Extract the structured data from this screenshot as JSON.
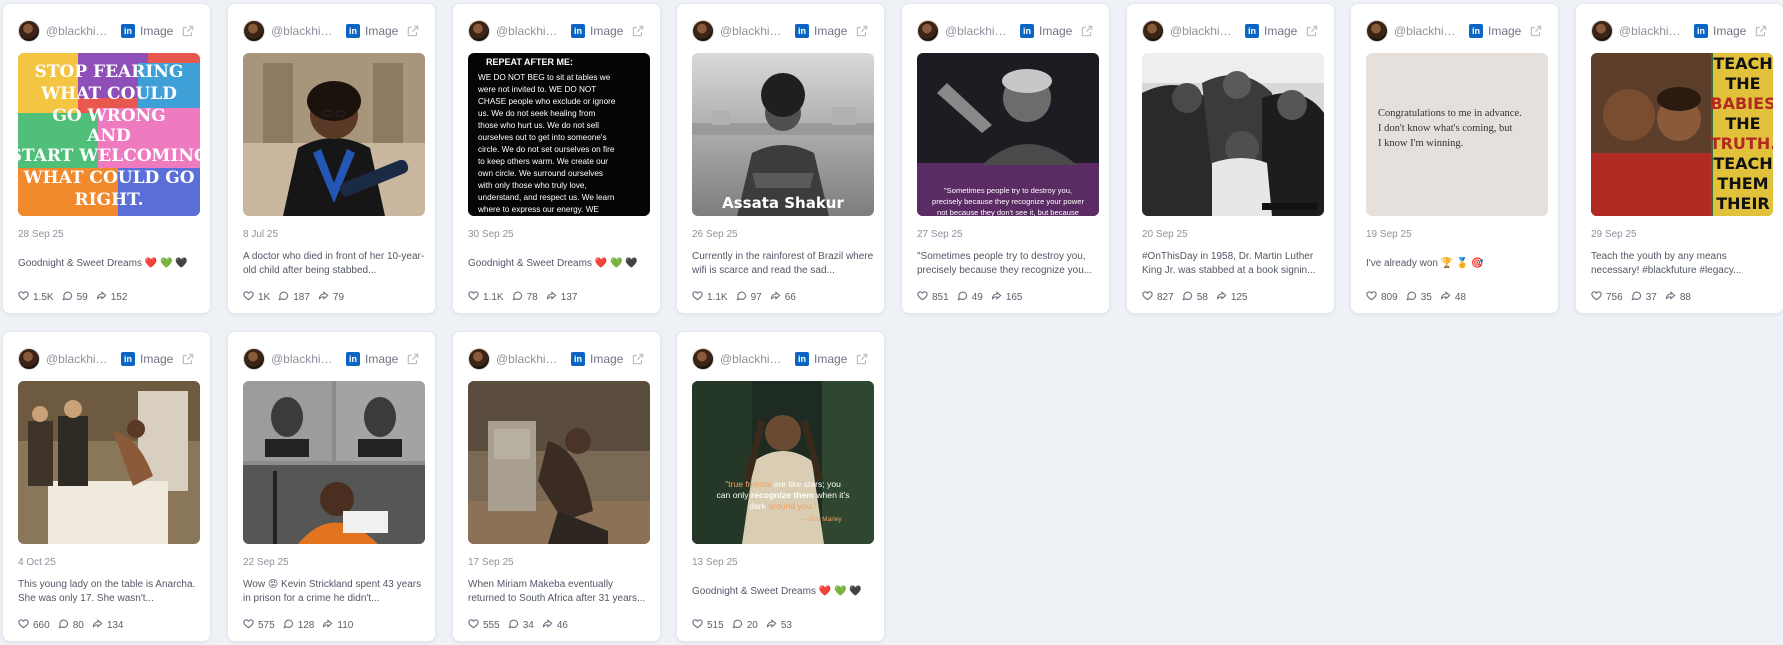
{
  "colors": {
    "linkedin": "#0a66c2",
    "page_background": "#eef1f6",
    "card_background": "#ffffff"
  },
  "icons": {
    "like": "heart-icon",
    "comment": "comment-icon",
    "share": "share-icon",
    "platform": "linkedin-icon",
    "open": "external-link-icon"
  },
  "cards": [
    {
      "handle": "@blackhist...",
      "type": "Image",
      "date": "28 Sep 25",
      "caption": "Goodnight & Sweet Dreams ❤️ 💚 🖤",
      "likes": "1.5K",
      "comments": "59",
      "shares": "152",
      "image_text": "STOP FEARING WHAT COULD GO WRONG AND START WELCOMING WHAT COULD GO RIGHT."
    },
    {
      "handle": "@blackhist...",
      "type": "Image",
      "date": "8 Jul 25",
      "caption": "A doctor who died in front of her 10-year-old child after being stabbed...",
      "likes": "1K",
      "comments": "187",
      "shares": "79",
      "image_text": ""
    },
    {
      "handle": "@blackhist...",
      "type": "Image",
      "date": "30 Sep 25",
      "caption": "Goodnight & Sweet Dreams ❤️ 💚 🖤",
      "likes": "1.1K",
      "comments": "78",
      "shares": "137",
      "image_text": "REPEAT AFTER ME: WE DO NOT BEG to sit at tables we were not invited to. WE DO NOT CHASE people who exclude or ignore us. We do not seek healing from those who hurt us. We do not sell ourselves out to get into someone's circle. We do not set ourselves on fire to keep others warm. We create our own circle. We surround ourselves with only those who truly love, understand, and respect us. We learn where to express our energy. WE REMEMBER OUR SELF-WORTH."
    },
    {
      "handle": "@blackhist...",
      "type": "Image",
      "date": "26 Sep 25",
      "caption": "Currently in the rainforest of Brazil where wifi is scarce and read the sad...",
      "likes": "1.1K",
      "comments": "97",
      "shares": "66",
      "image_text": "Assata Shakur"
    },
    {
      "handle": "@blackhist...",
      "type": "Image",
      "date": "27 Sep 25",
      "caption": "\"Sometimes people try to destroy you, precisely because they recognize you...",
      "likes": "851",
      "comments": "49",
      "shares": "165",
      "image_text": "\"Sometimes people try to destroy you, precisely because they recognize your power not because they don't see it, but because"
    },
    {
      "handle": "@blackhist...",
      "type": "Image",
      "date": "20 Sep 25",
      "caption": "#OnThisDay in 1958, Dr. Martin Luther King Jr. was stabbed at a book signin...",
      "likes": "827",
      "comments": "58",
      "shares": "125",
      "image_text": ""
    },
    {
      "handle": "@blackhist...",
      "type": "Image",
      "date": "19 Sep 25",
      "caption": "I've already won 🏆 🏅 🎯",
      "likes": "809",
      "comments": "35",
      "shares": "48",
      "image_text": "Congratulations to me in advance. I don't know what's coming, but I know I'm winning."
    },
    {
      "handle": "@blackhist...",
      "type": "Image",
      "date": "29 Sep 25",
      "caption": "Teach the youth by any means necessary! #blackfuture #legacy...",
      "likes": "756",
      "comments": "37",
      "shares": "88",
      "image_text": "TEACH THE BABIES THE TRUTH. TEACH THEM THEIR"
    },
    {
      "handle": "@blackhist...",
      "type": "Image",
      "date": "4 Oct 25",
      "caption": "This young lady on the table is Anarcha. She was only 17. She wasn't...",
      "likes": "660",
      "comments": "80",
      "shares": "134",
      "image_text": ""
    },
    {
      "handle": "@blackhist...",
      "type": "Image",
      "date": "22 Sep 25",
      "caption": "Wow 😡 Kevin Strickland spent 43 years in prison for a crime he didn't...",
      "likes": "575",
      "comments": "128",
      "shares": "110",
      "image_text": ""
    },
    {
      "handle": "@blackhist...",
      "type": "Image",
      "date": "17 Sep 25",
      "caption": "When Miriam Makeba eventually returned to South Africa after 31 years...",
      "likes": "555",
      "comments": "34",
      "shares": "46",
      "image_text": ""
    },
    {
      "handle": "@blackhist...",
      "type": "Image",
      "date": "13 Sep 25",
      "caption": "Goodnight & Sweet Dreams ❤️ 💚 🖤",
      "likes": "515",
      "comments": "20",
      "shares": "53",
      "image_text": "\"true friends are like stars; you can only recognize them when it's dark around you.\" —Bob Marley"
    }
  ]
}
